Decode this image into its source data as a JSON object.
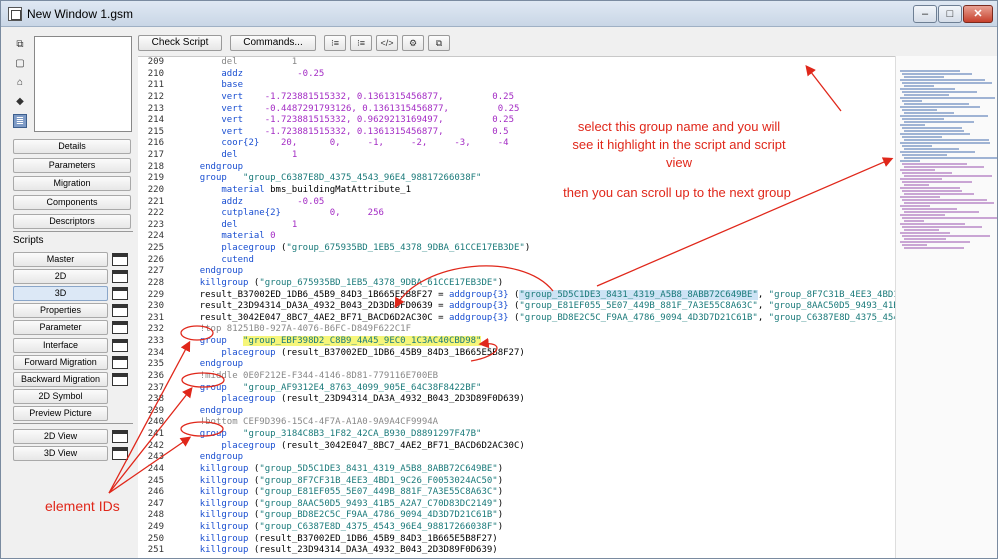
{
  "window": {
    "title": "New Window 1.gsm",
    "min": "–",
    "max": "□",
    "close": "✕"
  },
  "tools": [
    {
      "name": "2d-tool-icon",
      "glyph": "⧉"
    },
    {
      "name": "3d-tool-icon",
      "glyph": "▢"
    },
    {
      "name": "building-tool-icon",
      "glyph": "⌂"
    },
    {
      "name": "cube-tool-icon",
      "glyph": "◆"
    },
    {
      "name": "list-tool-icon",
      "glyph": "≣"
    }
  ],
  "left_buttons": [
    "Details",
    "Parameters",
    "Migration",
    "Components",
    "Descriptors"
  ],
  "scripts_label": "Scripts",
  "script_buttons": [
    "Master",
    "2D",
    "3D",
    "Properties",
    "Parameter",
    "Interface",
    "Forward Migration",
    "Backward Migration",
    "2D Symbol",
    "Preview Picture"
  ],
  "view_buttons": [
    "2D View",
    "3D View"
  ],
  "toolbar": {
    "check_script": "Check Script",
    "commands": "Commands...",
    "icons": [
      "⁝≡",
      "⁝≡",
      "</>",
      "⚙",
      "⧉"
    ]
  },
  "code_lines": [
    {
      "n": "209",
      "html": "<span class='gry'>        del          1</span>"
    },
    {
      "n": "210",
      "html": "        <span class='kw'>addz</span>          <span class='pur'>-0.25</span>"
    },
    {
      "n": "211",
      "html": "        <span class='kw'>base</span>"
    },
    {
      "n": "212",
      "html": "        <span class='kw'>vert</span>    <span class='pur'>-1.723881515332, 0.1361315456877,         0.25</span>"
    },
    {
      "n": "213",
      "html": "        <span class='kw'>vert</span>    <span class='pur'>-0.4487291793126, 0.1361315456877,         0.25</span>"
    },
    {
      "n": "214",
      "html": "        <span class='kw'>vert</span>    <span class='pur'>-1.723881515332, 0.9629213169497,         0.25</span>"
    },
    {
      "n": "215",
      "html": "        <span class='kw'>vert</span>    <span class='pur'>-1.723881515332, 0.1361315456877,         0.5</span>"
    },
    {
      "n": "216",
      "html": "        <span class='kw'>coor{2}</span>    <span class='pur'>20,      0,     -1,     -2,     -3,     -4</span>"
    },
    {
      "n": "217",
      "html": "        <span class='kw'>del</span>          <span class='pur'>1</span>"
    },
    {
      "n": "218",
      "html": "    <span class='kw'>endgroup</span>"
    },
    {
      "n": "219",
      "html": "    <span class='kw'>group</span>   <span class='str'>\"group_C6387E8D_4375_4543_96E4_98817266038F\"</span>"
    },
    {
      "n": "220",
      "html": "        <span class='kw'>material</span> bms_buildingMatAttribute_1"
    },
    {
      "n": "221",
      "html": "        <span class='kw'>addz</span>          <span class='pur'>-0.05</span>"
    },
    {
      "n": "222",
      "html": "        <span class='kw'>cutplane{2}</span>         <span class='pur'>0,     256</span>"
    },
    {
      "n": "223",
      "html": "        <span class='kw'>del</span>          <span class='pur'>1</span>"
    },
    {
      "n": "224",
      "html": "        <span class='kw'>material</span> <span class='pur'>0</span>"
    },
    {
      "n": "225",
      "html": "        <span class='kw'>placegroup</span> (<span class='str'>\"group_675935BD_1EB5_4378_9DBA_61CCE17EB3DE\"</span>)"
    },
    {
      "n": "226",
      "html": "        <span class='kw'>cutend</span>"
    },
    {
      "n": "227",
      "html": "    <span class='kw'>endgroup</span>"
    },
    {
      "n": "228",
      "html": "    <span class='kw'>killgroup</span> (<span class='str'>\"group_675935BD_1EB5_4378_9DBA_61CCE17EB3DE\"</span>)"
    },
    {
      "n": "229",
      "html": "    result_B37002ED_1DB6_45B9_84D3_1B665E5B8F27 = <span class='kw'>addgroup{3}</span> (<span class='str hl2'>\"group_5D5C1DE3_8431_4319_A5B8_8ABB72C649BE\"</span>, <span class='str'>\"group_8F7C31B_4EE3_4BD1_9C26_F0053024/</span>"
    },
    {
      "n": "230",
      "html": "    result_23D94314_DA3A_4932_B043_2D3DB9FD0639 = <span class='kw'>addgroup{3}</span> (<span class='str'>\"group_E81EF055_5E07_449B_881F_7A3E55C8A63C\"</span>, <span class='str'>\"group_8AAC50D5_9493_41B5_A2A7_C70D83DC</span>"
    },
    {
      "n": "231",
      "html": "    result_3042E047_8BC7_4AE2_BF71_BACD6D2AC30C = <span class='kw'>addgroup{3}</span> (<span class='str'>\"group_BD8E2C5C_F9AA_4786_9094_4D3D7D21C61B\"</span>, <span class='str'>\"group_C6387E8D_4375_4543_96E4_98817266</span>"
    },
    {
      "n": "232",
      "html": "    <span class='gry'>!top 81251B0-927A-4076-B6FC-D849F622C1F</span>"
    },
    {
      "n": "233",
      "html": "    <span class='kw'>group</span>   <span class='str hl'>\"group_EBF398D2_C8B9_4A45_9EC0_1C3AC40CBD98\"</span>"
    },
    {
      "n": "234",
      "html": "        <span class='kw'>placegroup</span> (result_B37002ED_1DB6_45B9_84D3_1B665E5B8F27)"
    },
    {
      "n": "235",
      "html": "    <span class='kw'>endgroup</span>"
    },
    {
      "n": "236",
      "html": "    <span class='gry'>!middle 0E0F212E-F344-4146-8D81-779116E700EB</span>"
    },
    {
      "n": "237",
      "html": "    <span class='kw'>group</span>   <span class='str'>\"group_AF9312E4_8763_4099_905E_64C38F8422BF\"</span>"
    },
    {
      "n": "238",
      "html": "        <span class='kw'>placegroup</span> (result_23D94314_DA3A_4932_B043_2D3D89F0D639)"
    },
    {
      "n": "239",
      "html": "    <span class='kw'>endgroup</span>"
    },
    {
      "n": "240",
      "html": "    <span class='gry'>!bottom CEF9D396-15C4-4F7A-A1A0-9A9A4CF9994A</span>"
    },
    {
      "n": "241",
      "html": "    <span class='kw'>group</span>   <span class='str'>\"group_3184C8B3_1F82_42CA_B930_D8891297F47B\"</span>"
    },
    {
      "n": "242",
      "html": "        <span class='kw'>placegroup</span> (result_3042E047_8BC7_4AE2_BF71_BACD6D2AC30C)"
    },
    {
      "n": "243",
      "html": "    <span class='kw'>endgroup</span>"
    },
    {
      "n": "244",
      "html": "    <span class='kw'>killgroup</span> (<span class='str'>\"group_5D5C1DE3_8431_4319_A5B8_8ABB72C649BE\"</span>)"
    },
    {
      "n": "245",
      "html": "    <span class='kw'>killgroup</span> (<span class='str'>\"group_8F7CF31B_4EE3_4BD1_9C26_F0053024AC50\"</span>)"
    },
    {
      "n": "246",
      "html": "    <span class='kw'>killgroup</span> (<span class='str'>\"group_E81EF055_5E07_449B_881F_7A3E55C8A63C\"</span>)"
    },
    {
      "n": "247",
      "html": "    <span class='kw'>killgroup</span> (<span class='str'>\"group_8AAC50D5_9493_41B5_A2A7_C70D83DC2149\"</span>)"
    },
    {
      "n": "248",
      "html": "    <span class='kw'>killgroup</span> (<span class='str'>\"group_BD8E2C5C_F9AA_4786_9094_4D3D7D21C61B\"</span>)"
    },
    {
      "n": "249",
      "html": "    <span class='kw'>killgroup</span> (<span class='str'>\"group_C6387E8D_4375_4543_96E4_98817266038F\"</span>)"
    },
    {
      "n": "250",
      "html": "    <span class='kw'>killgroup</span> (result_B37002ED_1DB6_45B9_84D3_1B665E5B8F27)"
    },
    {
      "n": "251",
      "html": "    <span class='kw'>killgroup</span> (result_23D94314_DA3A_4932_B043_2D3D89F0D639)"
    }
  ],
  "annotations": {
    "select_note": "select this group name and you will see it highlight in the script and script view",
    "scroll_note": "then you can scroll up to the next group",
    "element_ids": "element IDs"
  },
  "annotation_color": "#e0271a"
}
